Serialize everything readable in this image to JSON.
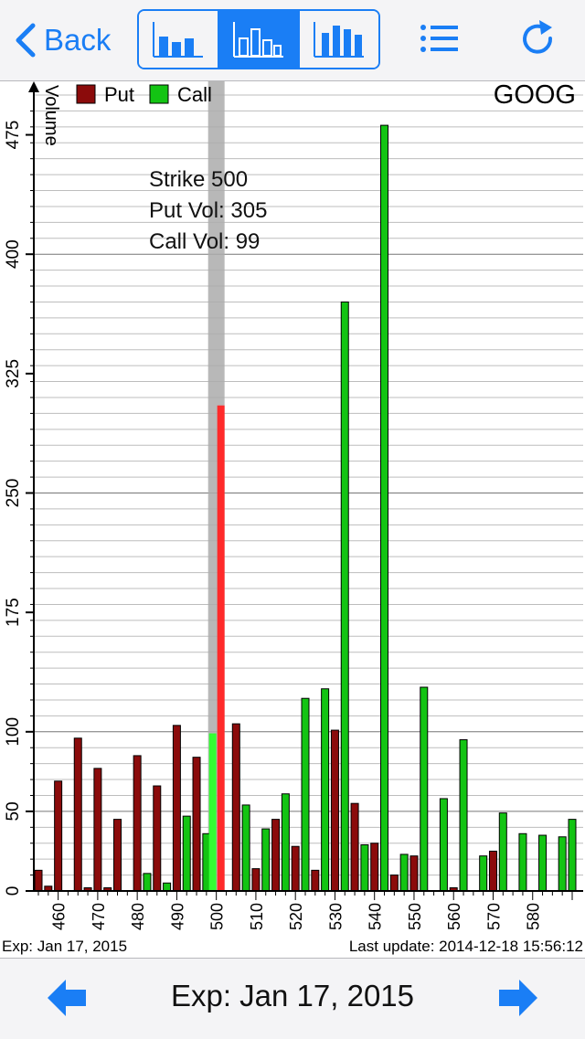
{
  "toolbar": {
    "back_label": "Back",
    "accent_color": "#1a7ef5",
    "view_modes": [
      {
        "name": "bar-chart-view-1",
        "icon": "grouped-bar-chart-icon",
        "active": false
      },
      {
        "name": "bar-chart-view-2",
        "icon": "bar-chart-icon",
        "active": true
      },
      {
        "name": "bar-chart-view-3",
        "icon": "stacked-bar-chart-icon",
        "active": false
      }
    ],
    "list_icon": "list-icon",
    "refresh_icon": "refresh-icon"
  },
  "chart_data": {
    "type": "bar",
    "title": "GOOG",
    "ylabel": "Volume",
    "ylim": [
      0,
      500
    ],
    "y_ticks": [
      0,
      50,
      100,
      175,
      250,
      325,
      400,
      475
    ],
    "x_tick_labels": [
      "460",
      "470",
      "480",
      "490",
      "500",
      "510",
      "520",
      "530",
      "540",
      "550",
      "560",
      "570",
      "580"
    ],
    "legend": [
      {
        "name": "Put",
        "color": "#8b0b0b"
      },
      {
        "name": "Call",
        "color": "#13c413"
      }
    ],
    "selected": {
      "strike": 500,
      "put_vol": 305,
      "call_vol": 99
    },
    "tooltip": {
      "strike": "Strike 500",
      "put_vol": "Put Vol: 305",
      "call_vol": "Call Vol: 99"
    },
    "strikes": [
      455,
      457.5,
      460,
      462.5,
      465,
      467.5,
      470,
      472.5,
      475,
      477.5,
      480,
      482.5,
      485,
      487.5,
      490,
      492.5,
      495,
      497.5,
      500,
      502.5,
      505,
      507.5,
      510,
      512.5,
      515,
      517.5,
      520,
      522.5,
      525,
      527.5,
      530,
      532.5,
      535,
      537.5,
      540,
      542.5,
      545,
      547.5,
      550,
      552.5,
      555,
      557.5,
      560,
      562.5,
      565,
      567.5,
      570,
      572.5,
      575,
      577.5,
      580,
      582.5,
      585,
      587.5,
      590
    ],
    "series": [
      {
        "name": "Put",
        "values": [
          13,
          3,
          69,
          0,
          96,
          2,
          77,
          2,
          45,
          0,
          85,
          0,
          66,
          0,
          104,
          0,
          84,
          0,
          305,
          0,
          105,
          0,
          14,
          0,
          45,
          0,
          28,
          0,
          13,
          0,
          101,
          0,
          55,
          0,
          30,
          0,
          10,
          0,
          22,
          0,
          0,
          0,
          2,
          0,
          0,
          0,
          25,
          0,
          0,
          0,
          0,
          0,
          0,
          0,
          0
        ]
      },
      {
        "name": "Call",
        "values": [
          0,
          0,
          0,
          0,
          0,
          0,
          0,
          0,
          0,
          0,
          0,
          11,
          0,
          5,
          0,
          47,
          0,
          36,
          99,
          0,
          0,
          54,
          0,
          39,
          0,
          61,
          0,
          121,
          0,
          127,
          0,
          370,
          0,
          29,
          0,
          481,
          0,
          23,
          0,
          128,
          0,
          58,
          0,
          95,
          0,
          22,
          0,
          49,
          0,
          36,
          0,
          35,
          0,
          34,
          45
        ]
      }
    ]
  },
  "footer": {
    "exp_label": "Exp: Jan 17, 2015",
    "last_update": "Last update: 2014-12-18 15:56:12"
  },
  "bottom": {
    "exp_date": "Exp: Jan 17, 2015",
    "prev_icon": "left-arrow-icon",
    "next_icon": "right-arrow-icon"
  }
}
